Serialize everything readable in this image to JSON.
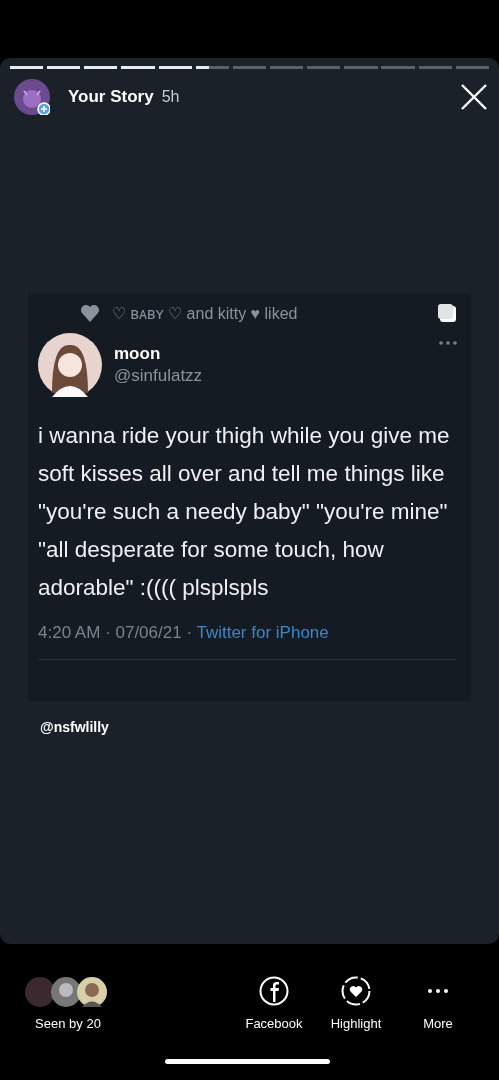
{
  "progress": {
    "level": 0.415
  },
  "header": {
    "title": "Your Story",
    "time": "5h"
  },
  "tweet": {
    "liked_by": "♡ ʙᴀʙʏ ♡ and kitty ♥ liked",
    "name": "moon",
    "handle": "@sinfulatzz",
    "text": "i wanna ride your thigh while you give me soft kisses all over and tell me things like \"you're such a needy baby\" \"you're mine\" \"all desperate for some touch, how adorable\" :(((( plsplspls",
    "meta": "4:20 AM · 07/06/21 · ",
    "source": "Twitter for iPhone"
  },
  "mention": "@nsfwlilly",
  "footer": {
    "seen": "Seen by 20",
    "actions": [
      {
        "kind": "facebook",
        "label": "Facebook"
      },
      {
        "kind": "highlight",
        "label": "Highlight"
      },
      {
        "kind": "more",
        "label": "More"
      }
    ]
  }
}
